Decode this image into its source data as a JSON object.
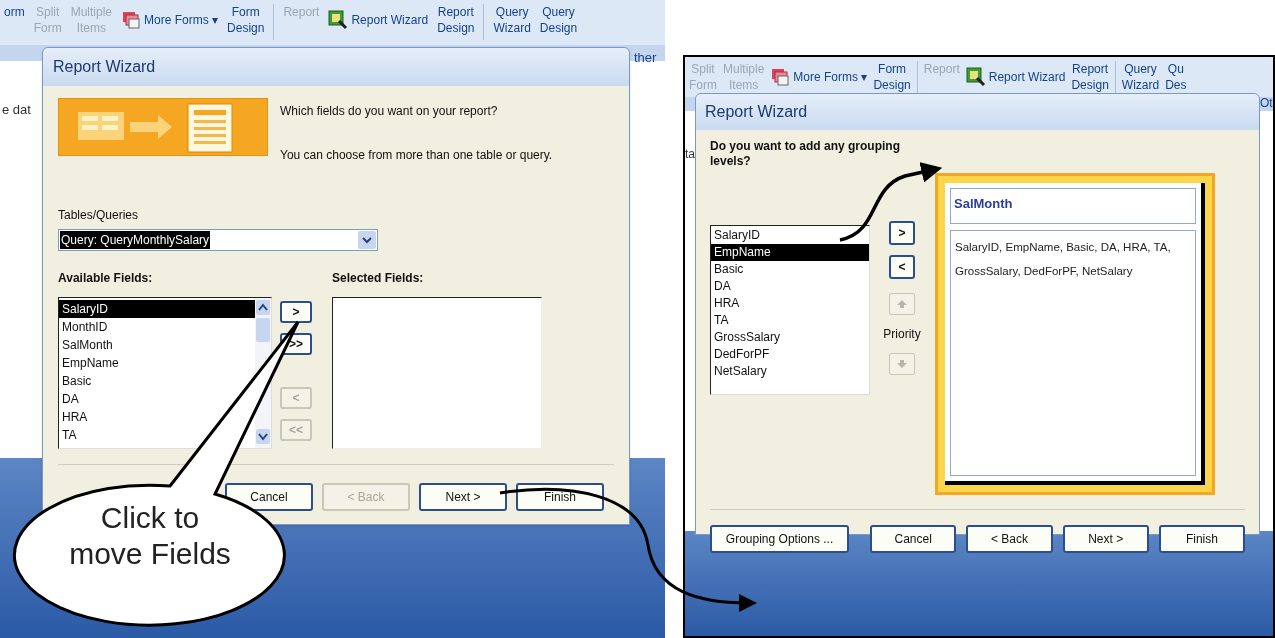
{
  "left_screen": {
    "ribbon": [
      {
        "kind": "stacked",
        "label": "orm",
        "disabled": false
      },
      {
        "kind": "stacked",
        "label": "Split\nForm",
        "disabled": true
      },
      {
        "kind": "stacked",
        "label": "Multiple\nItems",
        "disabled": true
      },
      {
        "kind": "forms",
        "label": "More Forms ▾",
        "disabled": false
      },
      {
        "kind": "stacked",
        "label": "Form\nDesign",
        "disabled": false
      },
      {
        "kind": "separator"
      },
      {
        "kind": "stacked",
        "label": "Report",
        "disabled": true
      },
      {
        "kind": "wizard",
        "label": "Report Wizard",
        "disabled": false
      },
      {
        "kind": "stacked",
        "label": "Report\nDesign",
        "disabled": false
      },
      {
        "kind": "separator"
      },
      {
        "kind": "stacked",
        "label": "Query\nWizard",
        "disabled": false
      },
      {
        "kind": "stacked",
        "label": "Query\nDesign",
        "disabled": false
      }
    ],
    "ribbon_caption": "ther",
    "side_text": "e dat",
    "dialog": {
      "title": "Report Wizard",
      "prompt": "Which fields do you want on your report?",
      "hint": "You can choose from more than one table or query.",
      "tables_label": "Tables/Queries",
      "tables_value": "Query: QueryMonthlySalary",
      "tables_value_highlighted": true,
      "available_label": "Available Fields:",
      "available_fields": [
        {
          "label": "SalaryID",
          "selected": true
        },
        {
          "label": "MonthID",
          "selected": false
        },
        {
          "label": "SalMonth",
          "selected": false
        },
        {
          "label": "EmpName",
          "selected": false
        },
        {
          "label": "Basic",
          "selected": false
        },
        {
          "label": "DA",
          "selected": false
        },
        {
          "label": "HRA",
          "selected": false
        },
        {
          "label": "TA",
          "selected": false
        }
      ],
      "transfer_buttons": [
        {
          "label": ">",
          "disabled": false
        },
        {
          "label": ">>",
          "disabled": false
        },
        {
          "label": "<",
          "disabled": true
        },
        {
          "label": "<<",
          "disabled": true
        }
      ],
      "selected_label": "Selected Fields:",
      "buttons": [
        {
          "label": "Cancel",
          "disabled": false
        },
        {
          "label": "< Back",
          "disabled": true
        },
        {
          "label": "Next >",
          "disabled": false
        },
        {
          "label": "Finish",
          "disabled": false
        }
      ]
    }
  },
  "callout": {
    "text": "Click to\nmove Fields"
  },
  "right_screen": {
    "ribbon": [
      {
        "kind": "stacked",
        "label": "Split\nForm",
        "disabled": true
      },
      {
        "kind": "stacked",
        "label": "Multiple\nItems",
        "disabled": true
      },
      {
        "kind": "forms",
        "label": "More Forms ▾",
        "disabled": false
      },
      {
        "kind": "stacked",
        "label": "Form\nDesign",
        "disabled": false
      },
      {
        "kind": "separator"
      },
      {
        "kind": "stacked",
        "label": "Report",
        "disabled": true
      },
      {
        "kind": "wizard",
        "label": "Report Wizard",
        "disabled": false
      },
      {
        "kind": "stacked",
        "label": "Report\nDesign",
        "disabled": false
      },
      {
        "kind": "separator"
      },
      {
        "kind": "stacked",
        "label": "Query\nWizard",
        "disabled": false
      },
      {
        "kind": "stacked",
        "label": "Qu\nDes",
        "disabled": false
      }
    ],
    "ribbon_caption": "Ot",
    "side_text": "ta",
    "dialog": {
      "title": "Report Wizard",
      "prompt": "Do you want to add any grouping levels?",
      "fields": [
        {
          "label": "SalaryID",
          "selected": false
        },
        {
          "label": "EmpName",
          "selected": true
        },
        {
          "label": "Basic",
          "selected": false
        },
        {
          "label": "DA",
          "selected": false
        },
        {
          "label": "HRA",
          "selected": false
        },
        {
          "label": "TA",
          "selected": false
        },
        {
          "label": "GrossSalary",
          "selected": false
        },
        {
          "label": "DedForPF",
          "selected": false
        },
        {
          "label": "NetSalary",
          "selected": false
        }
      ],
      "transfer_buttons": [
        {
          "label": ">",
          "disabled": false
        },
        {
          "label": "<",
          "disabled": false
        }
      ],
      "priority_up": {
        "disabled": true
      },
      "priority_label": "Priority",
      "priority_down": {
        "disabled": true
      },
      "group_header": "SalMonth",
      "group_fields": "SalaryID, EmpName, Basic, DA, HRA, TA, GrossSalary, DedForPF, NetSalary",
      "buttons": [
        {
          "label": "Grouping Options ...",
          "disabled": false
        },
        {
          "label": "Cancel",
          "disabled": false
        },
        {
          "label": "< Back",
          "disabled": false
        },
        {
          "label": "Next >",
          "disabled": false
        },
        {
          "label": "Finish",
          "disabled": false
        }
      ]
    }
  }
}
